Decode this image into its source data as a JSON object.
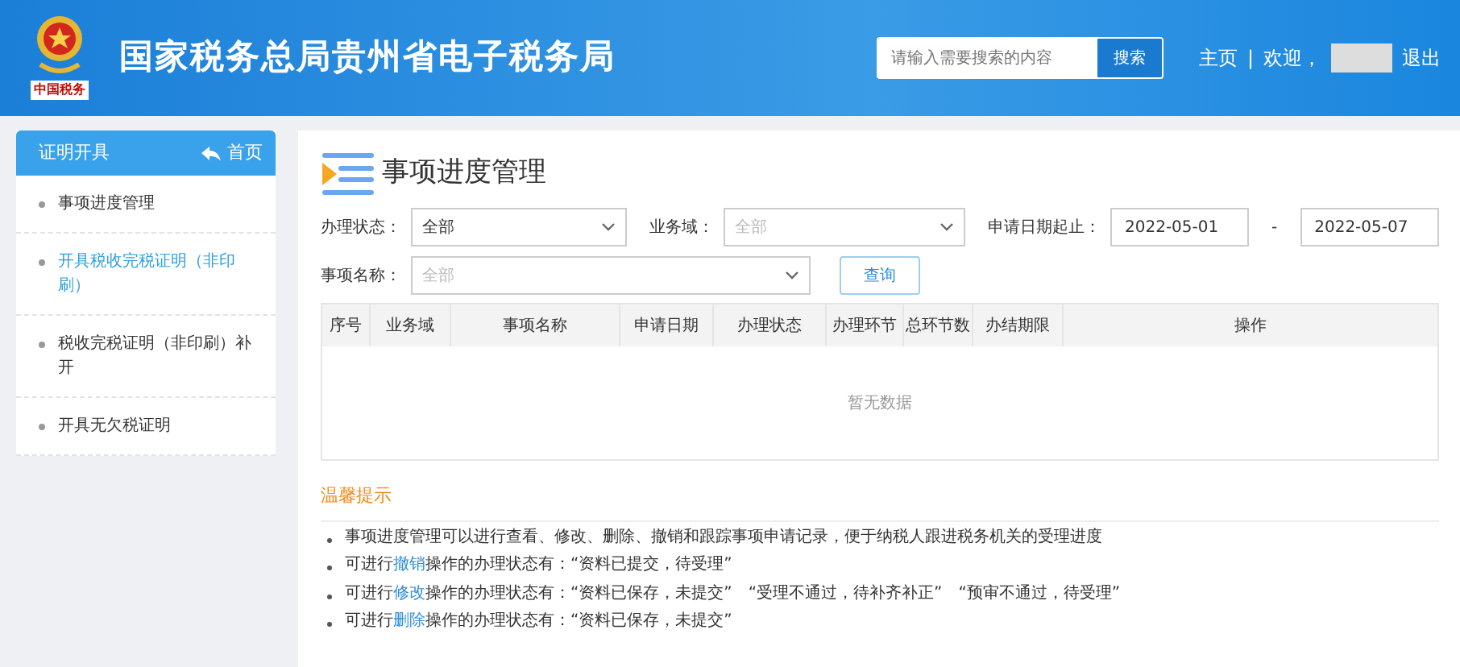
{
  "header": {
    "title": "国家税务总局贵州省电子税务局",
    "emblem_caption": "中国税务",
    "search": {
      "placeholder": "请输入需要搜索的内容",
      "button": "搜索"
    },
    "links": [
      "主页",
      "欢迎，"
    ],
    "separator": "|",
    "logout": "退出"
  },
  "sidebar": {
    "title": "证明开具",
    "home": "首页",
    "items": [
      {
        "label": "事项进度管理",
        "selected": false
      },
      {
        "label": "开具税收完税证明（非印刷）",
        "selected": true
      },
      {
        "label": "税收完税证明（非印刷）补开",
        "selected": false
      },
      {
        "label": "开具无欠税证明",
        "selected": false
      }
    ]
  },
  "main": {
    "title": "事项进度管理",
    "filters": [
      {
        "label": "办理状态：",
        "kind": "select",
        "value": "全部"
      },
      {
        "label": "业务域：",
        "kind": "select",
        "placeholder": "全部"
      },
      {
        "label": "申请日期起止：",
        "kind": "date-range",
        "from": "2022-05-01",
        "sep": "-",
        "to": "2022-05-07"
      },
      {
        "label": "事项名称：",
        "kind": "select",
        "placeholder": "全部"
      }
    ],
    "query_button": "查询",
    "table": {
      "columns": [
        "序号",
        "业务域",
        "事项名称",
        "申请日期",
        "办理状态",
        "办理环节",
        "总环节数",
        "办结期限",
        "操作"
      ],
      "empty": "暂无数据"
    },
    "tips": {
      "title": "温馨提示",
      "items": [
        {
          "before": "事项进度管理可以进行查看、修改、删除、撤销和跟踪事项申请记录，便于纳税人跟进税务机关的受理进度"
        },
        {
          "before": "可进行",
          "link": "撤销",
          "after": "操作的办理状态有：“资料已提交，待受理”"
        },
        {
          "before": "可进行",
          "link": "修改",
          "after": "操作的办理状态有：“资料已保存，未提交”　“受理不通过，待补齐补正”　“预审不通过，待受理”"
        },
        {
          "before": "可进行",
          "link": "删除",
          "after": "操作的办理状态有：“资料已保存，未提交”"
        }
      ]
    }
  }
}
